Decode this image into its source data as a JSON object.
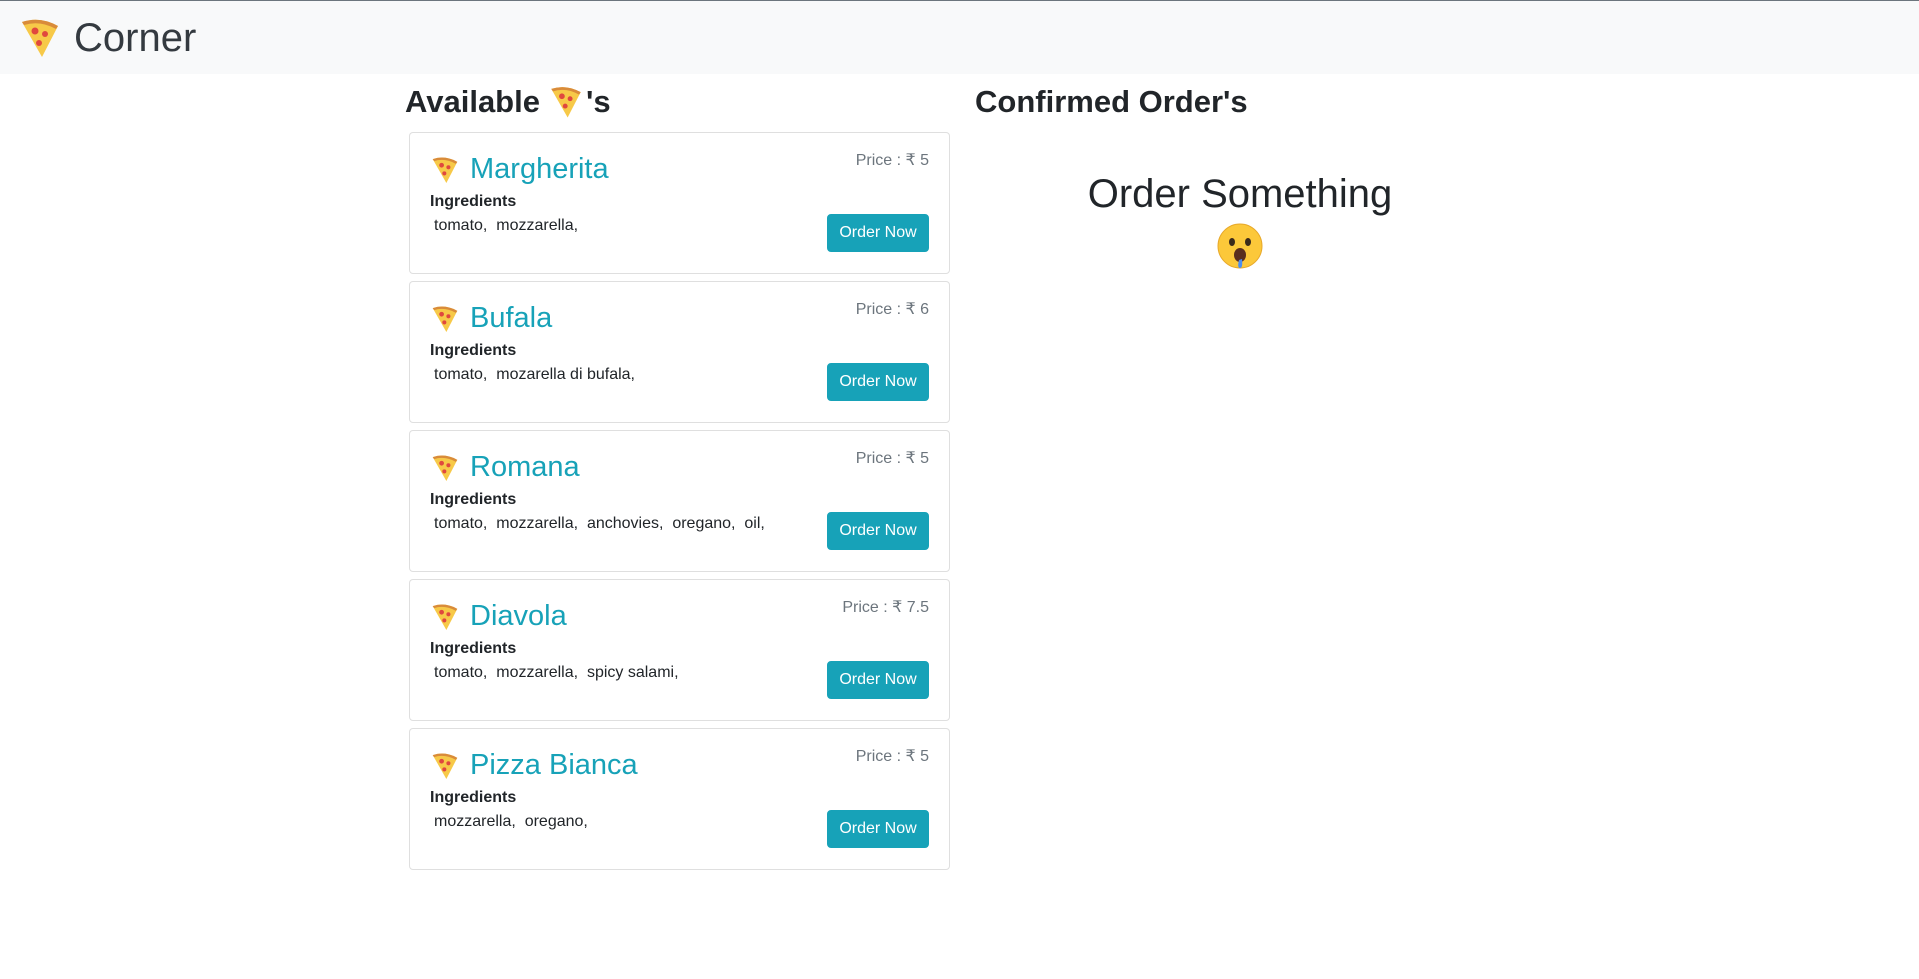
{
  "navbar": {
    "icon": "pizza-icon",
    "title": "Corner"
  },
  "available": {
    "heading_prefix": "Available",
    "heading_icon": "pizza-icon",
    "heading_suffix": "'s"
  },
  "confirmed": {
    "heading": "Confirmed Order's",
    "empty_text": "Order Something",
    "empty_icon": "drooling-face-icon"
  },
  "menu": [
    {
      "name": "Margherita",
      "price": "Price : ₹ 5",
      "ingredients_label": "Ingredients",
      "ingredients": "tomato,  mozzarella,",
      "button": "Order Now"
    },
    {
      "name": "Bufala",
      "price": "Price : ₹ 6",
      "ingredients_label": "Ingredients",
      "ingredients": "tomato,  mozarella di bufala,",
      "button": "Order Now"
    },
    {
      "name": "Romana",
      "price": "Price : ₹ 5",
      "ingredients_label": "Ingredients",
      "ingredients": "tomato,  mozzarella,  anchovies,  oregano,  oil,",
      "button": "Order Now"
    },
    {
      "name": "Diavola",
      "price": "Price : ₹ 7.5",
      "ingredients_label": "Ingredients",
      "ingredients": "tomato,  mozzarella,  spicy salami,",
      "button": "Order Now"
    },
    {
      "name": "Pizza Bianca",
      "price": "Price : ₹ 5",
      "ingredients_label": "Ingredients",
      "ingredients": "mozzarella,  oregano,",
      "button": "Order Now"
    }
  ],
  "colors": {
    "accent": "#17a2b8",
    "navbar_bg": "#f8f9fa",
    "muted": "#6c757d"
  }
}
